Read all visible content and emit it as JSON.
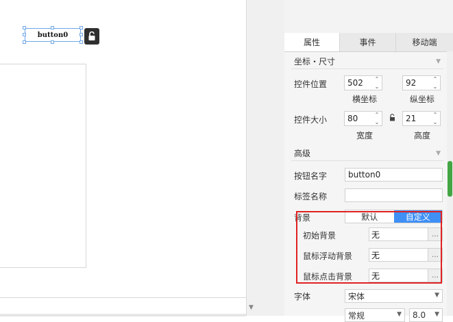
{
  "canvas": {
    "button_text": "button0"
  },
  "tabs": [
    {
      "label": "属性",
      "active": true
    },
    {
      "label": "事件",
      "active": false
    },
    {
      "label": "移动端",
      "active": false
    }
  ],
  "section_coords": {
    "title": "坐标・尺寸"
  },
  "position": {
    "label": "控件位置",
    "x_value": "502",
    "y_value": "92",
    "x_caption": "横坐标",
    "y_caption": "纵坐标"
  },
  "size": {
    "label": "控件大小",
    "width_value": "80",
    "height_value": "21",
    "width_caption": "宽度",
    "height_caption": "高度"
  },
  "section_advanced": {
    "title": "高级"
  },
  "button_name": {
    "label": "按钮名字",
    "value": "button0"
  },
  "tag_name": {
    "label": "标签名称",
    "value": ""
  },
  "background": {
    "label": "背景",
    "option_default": "默认",
    "option_custom": "自定义",
    "selected": "自定义",
    "initial": {
      "label": "初始背景",
      "value": "无"
    },
    "hover": {
      "label": "鼠标浮动背景",
      "value": "无"
    },
    "click": {
      "label": "鼠标点击背景",
      "value": "无"
    },
    "dots": "…"
  },
  "font": {
    "label": "字体",
    "value": "宋体",
    "style_value": "常规",
    "size_value": "8.0"
  },
  "colors": {
    "accent": "#3f8ff5",
    "highlight_frame": "#e02020",
    "scroll_thumb": "#44a544"
  }
}
